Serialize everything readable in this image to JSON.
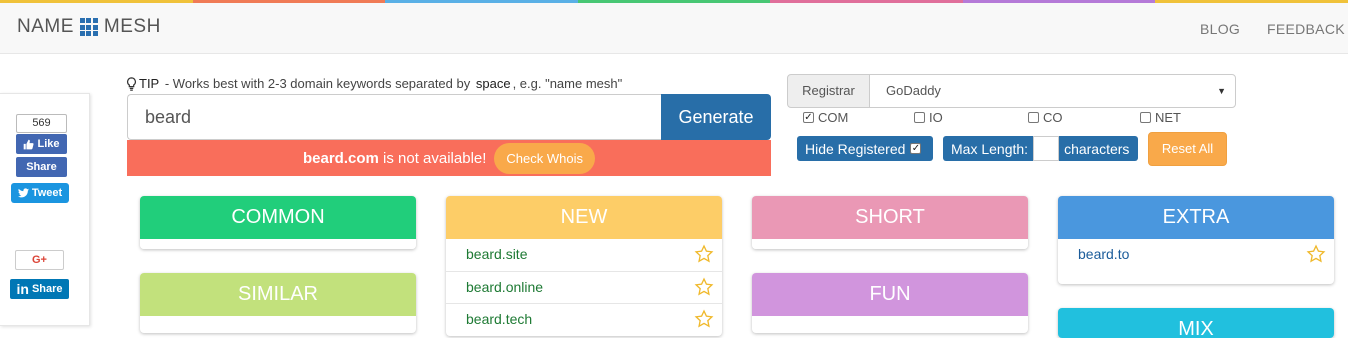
{
  "brand": {
    "left": "NAME",
    "right": "MESH"
  },
  "nav": {
    "blog": "BLOG",
    "feedback": "FEEDBACK"
  },
  "rainbow_colors": [
    "#f0c23a",
    "#f07b56",
    "#5ab0e6",
    "#48c774",
    "#e06f9b",
    "#b57ad8",
    "#f0c23a"
  ],
  "social": {
    "fb_count": "569",
    "fb_like": "Like",
    "fb_share": "Share",
    "tweet": "Tweet",
    "gplus": "G+",
    "linkedin": "Share"
  },
  "tip": {
    "label": "TIP",
    "text_a": " - Works best with 2-3 domain keywords separated by ",
    "keyword": "space",
    "text_b": ", e.g. \"name mesh\""
  },
  "search": {
    "value": "beard",
    "button": "Generate"
  },
  "alert": {
    "domain": "beard.com",
    "message": "is not available!",
    "whois": "Check Whois",
    "color": "#f96e5b"
  },
  "registrar": {
    "label": "Registrar",
    "selected": "GoDaddy"
  },
  "tlds": [
    {
      "label": "COM",
      "checked": true
    },
    {
      "label": "IO",
      "checked": false
    },
    {
      "label": "CO",
      "checked": false
    },
    {
      "label": "NET",
      "checked": false
    }
  ],
  "filters": {
    "hide_registered": "Hide Registered",
    "max_length": "Max Length:",
    "max_length_value": "",
    "characters": "characters",
    "reset": "Reset All"
  },
  "cards": {
    "common": {
      "title": "COMMON",
      "color": "#21ce7b",
      "items": []
    },
    "new": {
      "title": "NEW",
      "color": "#fdcd67",
      "items": [
        "beard.site",
        "beard.online",
        "beard.tech"
      ]
    },
    "short": {
      "title": "SHORT",
      "color": "#ea98b5",
      "items": []
    },
    "extra": {
      "title": "EXTRA",
      "color": "#4a97de",
      "items": [
        "beard.to"
      ]
    },
    "similar": {
      "title": "SIMILAR",
      "color": "#c2e17c",
      "items": []
    },
    "fun": {
      "title": "FUN",
      "color": "#d195dd",
      "items": []
    },
    "mix": {
      "title": "MIX",
      "color": "#21c0de",
      "items": []
    }
  }
}
